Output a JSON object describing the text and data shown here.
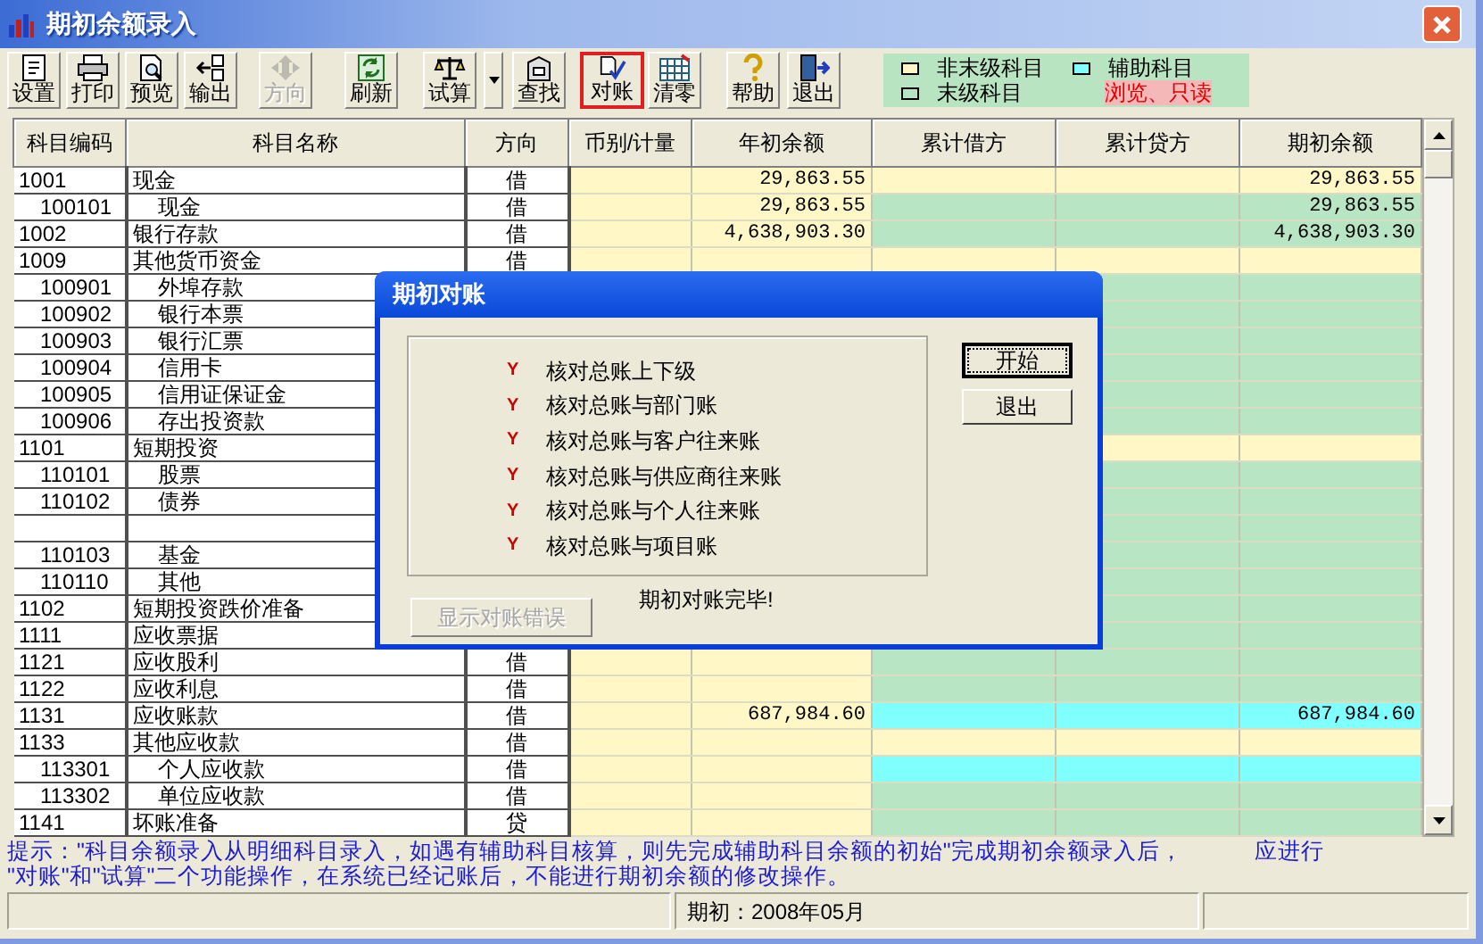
{
  "window": {
    "title": "期初余额录入"
  },
  "toolbar": [
    {
      "label": "设置",
      "disabled": false,
      "selected": false
    },
    {
      "label": "打印",
      "disabled": false,
      "selected": false
    },
    {
      "label": "预览",
      "disabled": false,
      "selected": false
    },
    {
      "label": "输出",
      "disabled": false,
      "selected": false
    },
    {
      "label": "方向",
      "disabled": true,
      "selected": false
    },
    {
      "label": "刷新",
      "disabled": false,
      "selected": false
    },
    {
      "label": "试算",
      "disabled": false,
      "selected": false,
      "dropdown": true
    },
    {
      "label": "查找",
      "disabled": false,
      "selected": false
    },
    {
      "label": "对账",
      "disabled": false,
      "selected": true
    },
    {
      "label": "清零",
      "disabled": false,
      "selected": false
    },
    {
      "label": "帮助",
      "disabled": false,
      "selected": false
    },
    {
      "label": "退出",
      "disabled": false,
      "selected": false
    }
  ],
  "legend": {
    "items": [
      {
        "label": "非末级科目",
        "color": "#fff8c6"
      },
      {
        "label": "辅助科目",
        "color": "#80ffff"
      },
      {
        "label": "末级科目",
        "color": "#b8e6c4"
      }
    ],
    "mode": "浏览、只读"
  },
  "table": {
    "columns": [
      "科目编码",
      "科目名称",
      "方向",
      "币别/计量",
      "年初余额",
      "累计借方",
      "累计贷方",
      "期初余额"
    ],
    "rows": [
      {
        "code": "1001",
        "name": "现金",
        "direction": "借",
        "kind": "parent",
        "opening_year": "29,863.55",
        "opening": "29,863.55",
        "children": [
          {
            "code": "100101",
            "name": "现金",
            "direction": "借",
            "kind": "leaf",
            "opening_year": "29,863.55",
            "opening": "29,863.55"
          }
        ]
      },
      {
        "code": "1002",
        "name": "银行存款",
        "direction": "借",
        "kind": "leaf",
        "opening_year": "4,638,903.30",
        "opening": "4,638,903.30"
      },
      {
        "code": "1009",
        "name": "其他货币资金",
        "direction": "借",
        "kind": "parent",
        "children": [
          {
            "code": "100901",
            "name": "外埠存款",
            "kind": "leaf"
          },
          {
            "code": "100902",
            "name": "银行本票",
            "kind": "leaf"
          },
          {
            "code": "100903",
            "name": "银行汇票",
            "kind": "leaf"
          },
          {
            "code": "100904",
            "name": "信用卡",
            "kind": "leaf"
          },
          {
            "code": "100905",
            "name": "信用证保证金",
            "kind": "leaf"
          },
          {
            "code": "100906",
            "name": "存出投资款",
            "kind": "leaf"
          }
        ]
      },
      {
        "code": "1101",
        "name": "短期投资",
        "kind": "parent",
        "children": [
          {
            "code": "110101",
            "name": "股票",
            "kind": "leaf"
          },
          {
            "code": "110102",
            "name": "债券",
            "kind": "leaf"
          },
          {
            "kind": "leaf"
          },
          {
            "code": "110103",
            "name": "基金",
            "kind": "leaf"
          },
          {
            "code": "110110",
            "name": "其他",
            "kind": "leaf"
          }
        ]
      },
      {
        "code": "1102",
        "name": "短期投资跌价准备",
        "kind": "leaf"
      },
      {
        "code": "1111",
        "name": "应收票据",
        "kind": "leaf"
      },
      {
        "code": "1121",
        "name": "应收股利",
        "direction": "借",
        "kind": "leaf"
      },
      {
        "code": "1122",
        "name": "应收利息",
        "direction": "借",
        "kind": "leaf"
      },
      {
        "code": "1131",
        "name": "应收账款",
        "direction": "借",
        "kind": "auxiliary",
        "opening_year": "687,984.60",
        "opening": "687,984.60"
      },
      {
        "code": "1133",
        "name": "其他应收款",
        "direction": "借",
        "kind": "parent",
        "children": [
          {
            "code": "113301",
            "name": "个人应收款",
            "direction": "借",
            "kind": "auxiliary"
          },
          {
            "code": "113302",
            "name": "单位应收款",
            "direction": "借",
            "kind": "leaf"
          }
        ]
      },
      {
        "code": "1141",
        "name": "坏账准备",
        "direction": "贷",
        "kind": "leaf"
      }
    ]
  },
  "hint": {
    "lines": [
      {
        "text": "提示：\"科目余额录入从明细科目录入，如遇有辅助科目核算，则先完成辅助科目余额的初始\"完成期初余额录入后，",
        "trailing": "应进行"
      },
      {
        "text": "\"对账\"和\"试算\"二个功能操作，在系统已经记账后，不能进行期初余额的修改操作。"
      }
    ]
  },
  "status_bar": {
    "period": "期初：2008年05月"
  },
  "dialog": {
    "title": "期初对账",
    "checks": [
      {
        "mark": "Y",
        "label": "核对总账上下级"
      },
      {
        "mark": "Y",
        "label": "核对总账与部门账"
      },
      {
        "mark": "Y",
        "label": "核对总账与客户往来账"
      },
      {
        "mark": "Y",
        "label": "核对总账与供应商往来账"
      },
      {
        "mark": "Y",
        "label": "核对总账与个人往来账"
      },
      {
        "mark": "Y",
        "label": "核对总账与项目账"
      }
    ],
    "buttons": [
      {
        "label": "开始",
        "focused": true
      },
      {
        "label": "退出",
        "focused": false
      }
    ],
    "message": "期初对账完毕!",
    "error_button": {
      "label": "显示对账错误",
      "disabled": true
    }
  }
}
